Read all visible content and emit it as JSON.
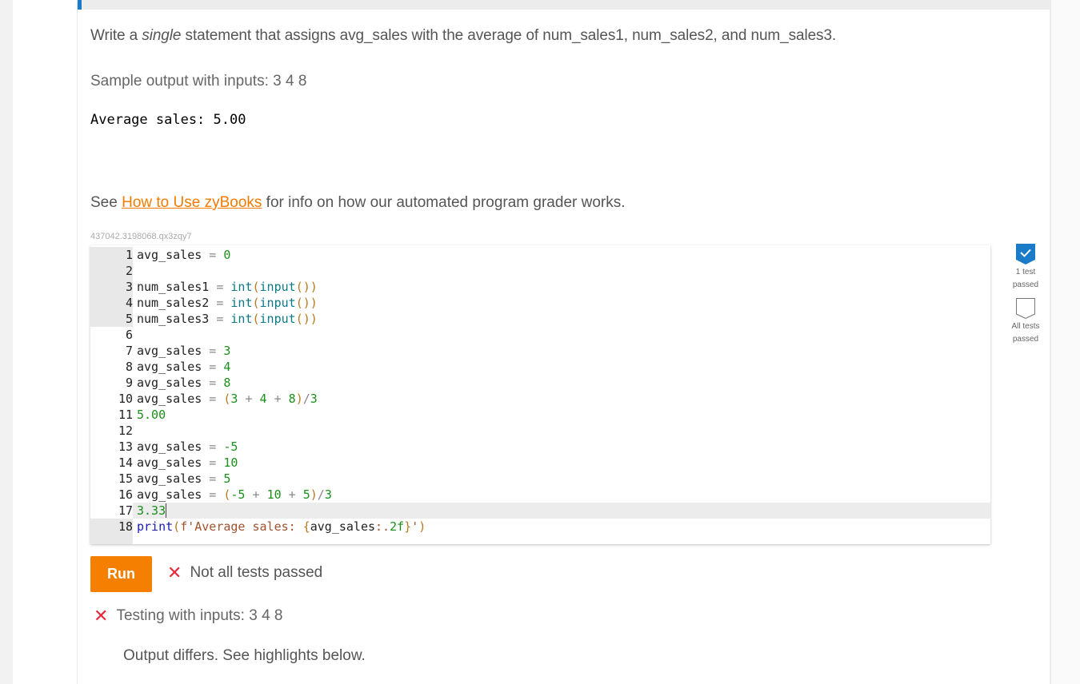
{
  "prompt": {
    "before_em": "Write a ",
    "em": "single",
    "after_em": " statement that assigns avg_sales with the average of num_sales1, num_sales2, and num_sales3."
  },
  "sample": {
    "label": "Sample output with inputs: 3 4 8",
    "output": "Average sales: 5.00"
  },
  "help": {
    "prefix": "See ",
    "link_text": "How to Use zyBooks",
    "suffix": " for info on how our automated program grader works."
  },
  "challenge_id": "437042.3198068.qx3zqy7",
  "editor": {
    "lines": [
      {
        "n": "1",
        "readonly": true,
        "tokens": [
          [
            "var",
            "avg_sales"
          ],
          [
            "op",
            " = "
          ],
          [
            "num",
            "0"
          ]
        ]
      },
      {
        "n": "2",
        "readonly": true,
        "tokens": []
      },
      {
        "n": "3",
        "readonly": true,
        "tokens": [
          [
            "var",
            "num_sales1"
          ],
          [
            "op",
            " = "
          ],
          [
            "builtin",
            "int"
          ],
          [
            "paren",
            "("
          ],
          [
            "builtin",
            "input"
          ],
          [
            "paren",
            "())"
          ]
        ]
      },
      {
        "n": "4",
        "readonly": true,
        "tokens": [
          [
            "var",
            "num_sales2"
          ],
          [
            "op",
            " = "
          ],
          [
            "builtin",
            "int"
          ],
          [
            "paren",
            "("
          ],
          [
            "builtin",
            "input"
          ],
          [
            "paren",
            "())"
          ]
        ]
      },
      {
        "n": "5",
        "readonly": true,
        "tokens": [
          [
            "var",
            "num_sales3"
          ],
          [
            "op",
            " = "
          ],
          [
            "builtin",
            "int"
          ],
          [
            "paren",
            "("
          ],
          [
            "builtin",
            "input"
          ],
          [
            "paren",
            "())"
          ]
        ]
      },
      {
        "n": "6",
        "readonly": false,
        "tokens": []
      },
      {
        "n": "7",
        "readonly": false,
        "tokens": [
          [
            "var",
            "avg_sales"
          ],
          [
            "op",
            " = "
          ],
          [
            "num",
            "3"
          ]
        ]
      },
      {
        "n": "8",
        "readonly": false,
        "tokens": [
          [
            "var",
            "avg_sales"
          ],
          [
            "op",
            " = "
          ],
          [
            "num",
            "4"
          ]
        ]
      },
      {
        "n": "9",
        "readonly": false,
        "tokens": [
          [
            "var",
            "avg_sales"
          ],
          [
            "op",
            " = "
          ],
          [
            "num",
            "8"
          ]
        ]
      },
      {
        "n": "10",
        "readonly": false,
        "tokens": [
          [
            "var",
            "avg_sales"
          ],
          [
            "op",
            " = "
          ],
          [
            "paren",
            "("
          ],
          [
            "num",
            "3"
          ],
          [
            "op",
            " + "
          ],
          [
            "num",
            "4"
          ],
          [
            "op",
            " + "
          ],
          [
            "num",
            "8"
          ],
          [
            "paren",
            ")"
          ],
          [
            "op",
            "/"
          ],
          [
            "num",
            "3"
          ]
        ]
      },
      {
        "n": "11",
        "readonly": false,
        "tokens": [
          [
            "num",
            "5.00"
          ]
        ]
      },
      {
        "n": "12",
        "readonly": false,
        "tokens": []
      },
      {
        "n": "13",
        "readonly": false,
        "tokens": [
          [
            "var",
            "avg_sales"
          ],
          [
            "op",
            " = "
          ],
          [
            "num",
            "-5"
          ]
        ]
      },
      {
        "n": "14",
        "readonly": false,
        "tokens": [
          [
            "var",
            "avg_sales"
          ],
          [
            "op",
            " = "
          ],
          [
            "num",
            "10"
          ]
        ]
      },
      {
        "n": "15",
        "readonly": false,
        "tokens": [
          [
            "var",
            "avg_sales"
          ],
          [
            "op",
            " = "
          ],
          [
            "num",
            "5"
          ]
        ]
      },
      {
        "n": "16",
        "readonly": false,
        "tokens": [
          [
            "var",
            "avg_sales"
          ],
          [
            "op",
            " = "
          ],
          [
            "paren",
            "("
          ],
          [
            "num",
            "-5"
          ],
          [
            "op",
            " + "
          ],
          [
            "num",
            "10"
          ],
          [
            "op",
            " + "
          ],
          [
            "num",
            "5"
          ],
          [
            "paren",
            ")"
          ],
          [
            "op",
            "/"
          ],
          [
            "num",
            "3"
          ]
        ]
      },
      {
        "n": "17",
        "readonly": false,
        "active": true,
        "tokens": [
          [
            "num",
            "3.33"
          ]
        ]
      },
      {
        "n": "18",
        "readonly": true,
        "tokens": [
          [
            "kw",
            "print"
          ],
          [
            "paren",
            "("
          ],
          [
            "str",
            "f'Average sales: "
          ],
          [
            "paren",
            "{"
          ],
          [
            "var",
            "avg_sales"
          ],
          [
            "str",
            ":."
          ],
          [
            "num",
            "2f"
          ],
          [
            "paren",
            "}"
          ],
          [
            "str",
            "'"
          ],
          [
            "paren",
            ")"
          ]
        ]
      }
    ]
  },
  "run_button": "Run",
  "result": {
    "status_icon": "x-icon",
    "status_text": "Not all tests passed",
    "test_text": "Testing with inputs: 3 4 8",
    "diff_note": "Output differs. See highlights below."
  },
  "progress": [
    {
      "label_line1": "1 test",
      "label_line2": "passed",
      "state": "passed",
      "color": "#1a7cc9"
    },
    {
      "label_line1": "All tests",
      "label_line2": "passed",
      "state": "pending",
      "color": "#777777"
    }
  ],
  "colors": {
    "accent_blue": "#1a7cc9",
    "run_orange": "#f47f00",
    "link_orange": "#f37b00",
    "fail_red": "#e8283c"
  }
}
